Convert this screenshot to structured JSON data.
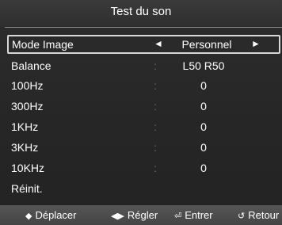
{
  "title": "Test du son",
  "menu": {
    "items": [
      {
        "label": "Mode Image",
        "value": "Personnel",
        "left_arrow": "◄",
        "right_arrow": "►"
      },
      {
        "label": "Balance",
        "sep": ":",
        "value": "L50 R50"
      },
      {
        "label": "100Hz",
        "sep": ":",
        "value": "0"
      },
      {
        "label": "300Hz",
        "sep": ":",
        "value": "0"
      },
      {
        "label": "1KHz",
        "sep": ":",
        "value": "0"
      },
      {
        "label": "3KHz",
        "sep": ":",
        "value": "0"
      },
      {
        "label": "10KHz",
        "sep": ":",
        "value": "0"
      },
      {
        "label": "Réinit."
      }
    ]
  },
  "footer": {
    "move": {
      "icon": "◆",
      "label": "Déplacer"
    },
    "adjust": {
      "icon": "◀▶",
      "label": "Régler"
    },
    "enter": {
      "icon": "⏎",
      "label": "Entrer"
    },
    "return": {
      "icon": "↺",
      "label": "Retour"
    }
  }
}
